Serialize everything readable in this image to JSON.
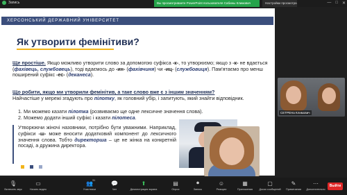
{
  "topbar": {
    "rec_label": "Запись",
    "share_banner": "Вы просматриваете PowerPoint пользователя Сабины Климович",
    "view_settings": "Настройки просмотра",
    "minimize": "—",
    "maximize": "□",
    "close": "✕"
  },
  "slide": {
    "university": "ХЕРСОНСЬКИЙ ДЕРЖАВНИЙ УНІВЕРСИТЕТ",
    "title": "Як утворити фемінітиви?",
    "para1_lead": "Ще простіше.",
    "para1_a": " Якщо можливо утворити слово за допомогою суфікса ",
    "para1_k": "-к-",
    "para1_b": ", то утворюємо; якщо з ",
    "para1_k2": "-к-",
    "para1_c": " не вдається (",
    "para1_ex1": "фахівець, службовець",
    "para1_d": "), тоді вдаємось до ",
    "para1_in": "-ин-",
    "para1_e": " (",
    "para1_ex2": "фахівчиня",
    "para1_f": ") чи ",
    "para1_ic": "-иц-",
    "para1_g": " (",
    "para1_ex3": "службовиця",
    "para1_h": "). Пам'ятаємо про менш поширений суфікс ",
    "para1_es": "-ес-",
    "para1_i": " (",
    "para1_ex4": "деканеса",
    "para1_j": ").",
    "para2_lead": "Що робити, якщо ми утворили фемінітив, а таке слово вже є з іншим значенням?",
    "para2_a": "Найчастіше у мережі згадують про ",
    "para2_ex": "пілотку",
    "para2_b": ", як головний убір, і запитують, який знайти відповідник.",
    "list1_a": "1.   Ми можемо казати ",
    "list1_ex": "пілотка",
    "list1_b": " (розвиваємо ще одне лексичне значення слова).",
    "list2_a": "2.   Можемо додати інший суфікс і казати ",
    "list2_ex": "пілотеса",
    "list2_b": ".",
    "note_a": "Утворюючи жіночі назовники, потрібно бути уважними. Наприклад, суфікси ",
    "note_sh": "-ш-",
    "note_b": " може вносити додатковий компонент до лексичного значення слова. Тобто ",
    "note_ex": "директорша",
    "note_c": " – це не жінка на конкретній посаді, а дружина директора."
  },
  "participant_tile": {
    "name": "СЕТРЕНа Климович"
  },
  "toolbar": {
    "mute": "Включить звук",
    "video": "Начать видео",
    "participants": "Участники",
    "participants_count": "31",
    "chat": "Чат",
    "share": "Демонстрация экрана",
    "poll": "Опрос",
    "record": "Запись",
    "reactions": "Реакции",
    "apps": "Приложения",
    "whiteboards": "Доски сообщений",
    "notes": "Примечания",
    "more": "Дополнительно",
    "end": "Выйти"
  },
  "colors": {
    "accent_navy": "#1f2f56",
    "uni_bar": "#3b4e7c",
    "underline": "#f2b41a",
    "share_green": "#25a34a",
    "end_red": "#e02828",
    "bullet_1": "#f2b41a",
    "bullet_2": "#3b4e7c",
    "bullet_3": "#9aa8c9"
  }
}
